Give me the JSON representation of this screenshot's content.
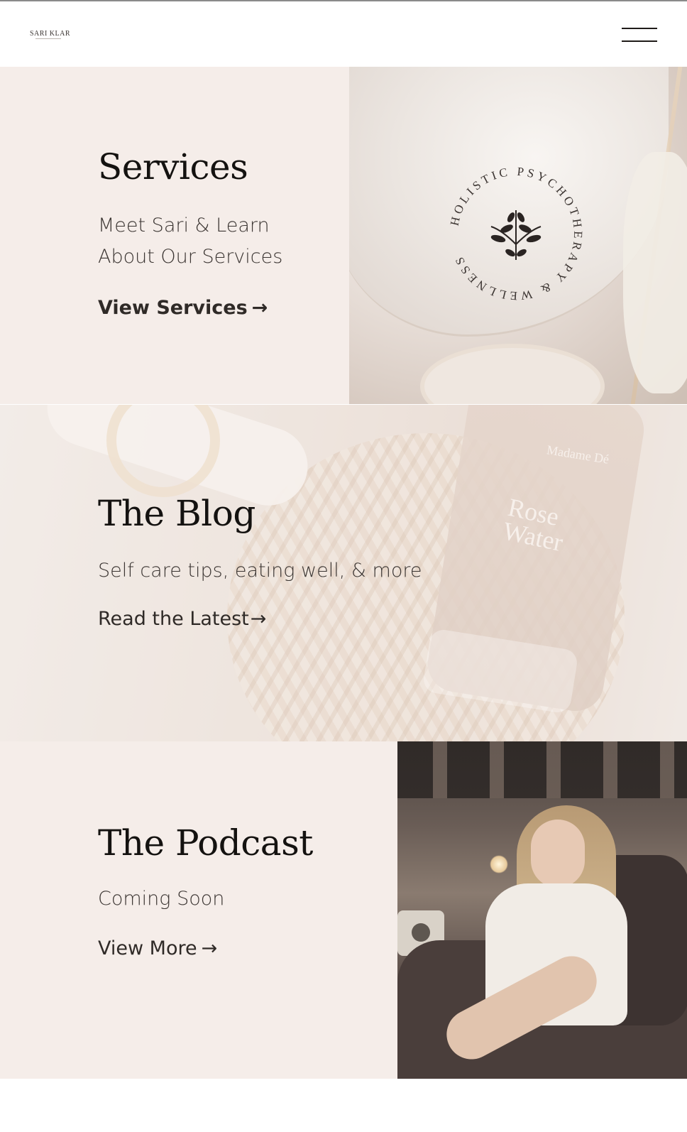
{
  "header": {
    "logo_text": "SARI KLAR",
    "menu_label": "Menu"
  },
  "services": {
    "title": "Services",
    "subtitle_line1": "Meet Sari & Learn",
    "subtitle_line2": "About Our Services",
    "cta": "View Services",
    "badge_text": "HOLISTIC PSYCHOTHERAPY & WELLNESS"
  },
  "blog": {
    "title": "The Blog",
    "subtitle": "Self care tips, eating well, & more",
    "cta": "Read the Latest",
    "bottle_brand": "Madame Dé",
    "bottle_name_line1": "Rose",
    "bottle_name_line2": "Water"
  },
  "podcast": {
    "title": "The Podcast",
    "subtitle": "Coming Soon",
    "cta": "View More"
  },
  "icons": {
    "arrow": "→",
    "menu": "hamburger-icon",
    "badge": "botanical-sprig-icon"
  },
  "colors": {
    "panel_bg": "#f5ede9",
    "heading": "#141210",
    "text": "#3b3532"
  }
}
